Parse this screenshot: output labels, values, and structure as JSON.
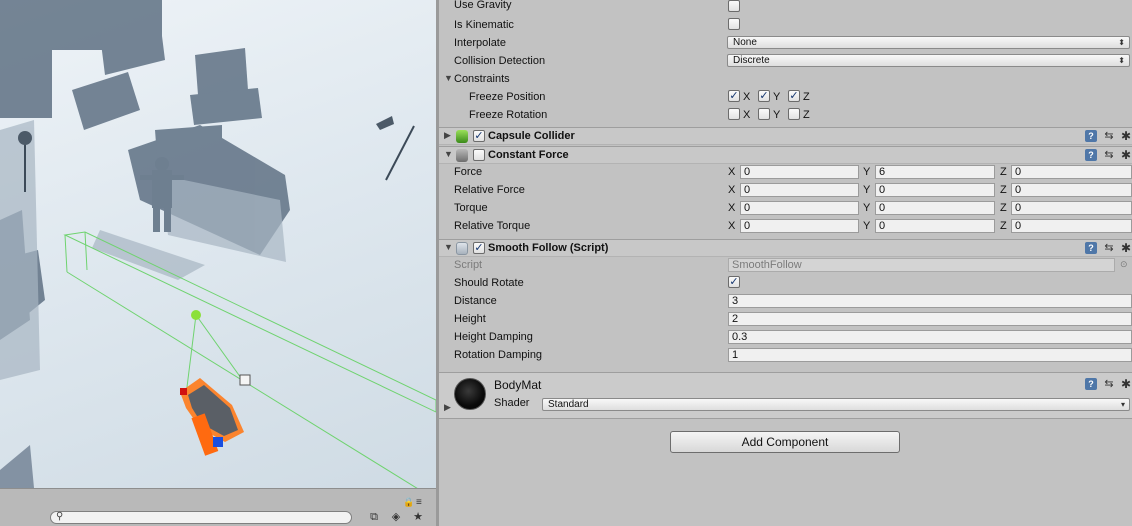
{
  "rigidbody": {
    "use_gravity": {
      "label": "Use Gravity",
      "checked": false
    },
    "is_kinematic": {
      "label": "Is Kinematic",
      "checked": false
    },
    "interpolate": {
      "label": "Interpolate",
      "value": "None"
    },
    "collision_detection": {
      "label": "Collision Detection",
      "value": "Discrete"
    },
    "constraints": {
      "label": "Constraints",
      "freeze_position": {
        "label": "Freeze Position",
        "x": "X",
        "y": "Y",
        "z": "Z"
      },
      "freeze_rotation": {
        "label": "Freeze Rotation",
        "x": "X",
        "y": "Y",
        "z": "Z"
      }
    }
  },
  "capsule_collider": {
    "title": "Capsule Collider"
  },
  "constant_force": {
    "title": "Constant Force",
    "rows": [
      {
        "label": "Force",
        "x": "0",
        "y": "6",
        "z": "0"
      },
      {
        "label": "Relative Force",
        "x": "0",
        "y": "0",
        "z": "0"
      },
      {
        "label": "Torque",
        "x": "0",
        "y": "0",
        "z": "0"
      },
      {
        "label": "Relative Torque",
        "x": "0",
        "y": "0",
        "z": "0"
      }
    ],
    "axis": {
      "x": "X",
      "y": "Y",
      "z": "Z"
    }
  },
  "smooth_follow": {
    "title": "Smooth Follow (Script)",
    "script": {
      "label": "Script",
      "value": "SmoothFollow"
    },
    "should_rotate": {
      "label": "Should Rotate"
    },
    "distance": {
      "label": "Distance",
      "value": "3"
    },
    "height": {
      "label": "Height",
      "value": "2"
    },
    "height_damping": {
      "label": "Height Damping",
      "value": "0.3"
    },
    "rotation_damping": {
      "label": "Rotation Damping",
      "value": "1"
    }
  },
  "material": {
    "name": "BodyMat",
    "shader_label": "Shader",
    "shader_value": "Standard"
  },
  "add_component": "Add Component",
  "glyphs": {
    "check": "✓",
    "help": "?",
    "preset": "⇆",
    "gear": "✱",
    "fold_open": "▼",
    "fold_closed": "▶",
    "dropdown": "⬍",
    "search": "⚲"
  }
}
